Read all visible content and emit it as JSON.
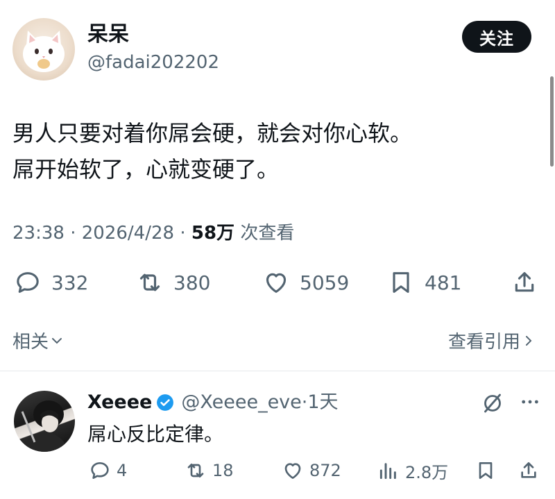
{
  "post": {
    "author": {
      "display_name": "呆呆",
      "handle": "@fadai202202",
      "avatar_icon": "cat-avatar-icon"
    },
    "follow_label": "关注",
    "text_lines": [
      "男人只要对着你屌会硬，就会对你心软。",
      "屌开始软了，心就变硬了。"
    ],
    "meta": {
      "time": "23:38",
      "separator": "·",
      "date": "2026/4/28",
      "views_count": "58万",
      "views_label": "次查看"
    },
    "actions": {
      "replies": "332",
      "reposts": "380",
      "likes": "5059",
      "bookmarks": "481"
    },
    "related_label": "相关",
    "view_quotes_label": "查看引用"
  },
  "reply": {
    "display_name": "Xeeee",
    "verified": true,
    "handle": "@Xeeee_eve",
    "separator": "·",
    "time_ago": "1天",
    "text": "屌心反比定律。",
    "actions": {
      "replies": "4",
      "reposts": "18",
      "likes": "872",
      "views": "2.8万"
    }
  },
  "colors": {
    "text_primary": "#0f1419",
    "text_secondary": "#536471",
    "verified_badge": "#1d9bf0",
    "follow_button_bg": "#0f1419"
  }
}
